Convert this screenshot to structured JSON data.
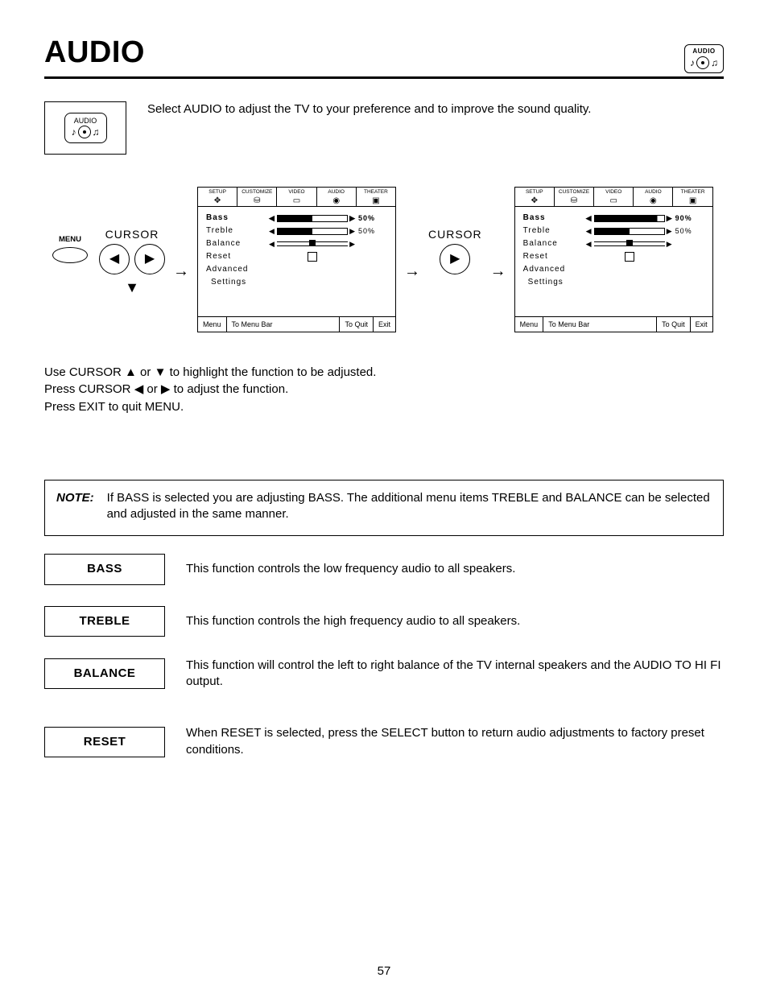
{
  "header": {
    "title": "AUDIO",
    "corner_label": "AUDIO"
  },
  "intro": {
    "icon_label": "AUDIO",
    "text": "Select AUDIO to adjust the TV to your preference and to improve the sound quality."
  },
  "remote": {
    "menu_label": "MENU",
    "cursor_label_1": "CURSOR",
    "cursor_label_2": "CURSOR"
  },
  "osd_common": {
    "tabs": [
      {
        "name": "SETUP"
      },
      {
        "name": "CUSTOMIZE"
      },
      {
        "name": "VIDEO"
      },
      {
        "name": "AUDIO"
      },
      {
        "name": "THEATER"
      }
    ],
    "items": {
      "bass": "Bass",
      "treble": "Treble",
      "balance": "Balance",
      "reset": "Reset",
      "adv1": "Advanced",
      "adv2": "Settings"
    },
    "footer": {
      "menu": "Menu",
      "to_menu_bar": "To Menu Bar",
      "to_quit": "To Quit",
      "exit": "Exit"
    }
  },
  "osd_left": {
    "bass_pct": "50%",
    "bass_fill": "50%",
    "treble_pct": "50%",
    "treble_fill": "50%"
  },
  "osd_right": {
    "bass_pct": "90%",
    "bass_fill": "90%",
    "treble_pct": "50%",
    "treble_fill": "50%"
  },
  "instructions": {
    "l1_a": "Use CURSOR ",
    "l1_b": " or ",
    "l1_c": " to highlight the function to be adjusted.",
    "l2_a": "Press CURSOR ",
    "l2_b": " or ",
    "l2_c": " to adjust the function.",
    "l3": "Press EXIT to quit MENU."
  },
  "note": {
    "label": "NOTE:",
    "text": "If BASS is selected you are adjusting BASS.  The additional menu items TREBLE and BALANCE can be selected and adjusted in the same manner."
  },
  "defs": {
    "bass": {
      "title": "BASS",
      "text": "This function controls the low frequency audio to all speakers."
    },
    "treble": {
      "title": "TREBLE",
      "text": "This function controls the high frequency audio to all speakers."
    },
    "balance": {
      "title": "BALANCE",
      "text": "This function will control the left to right balance of the TV internal speakers and the AUDIO TO HI FI output."
    },
    "reset": {
      "title": "RESET",
      "text": "When RESET is selected, press the SELECT button to return audio adjustments to factory preset conditions."
    }
  },
  "page_number": "57",
  "glyphs": {
    "up": "▲",
    "down": "▼",
    "left": "◀",
    "right": "▶",
    "note_l": "♪",
    "note_r": "♫"
  }
}
